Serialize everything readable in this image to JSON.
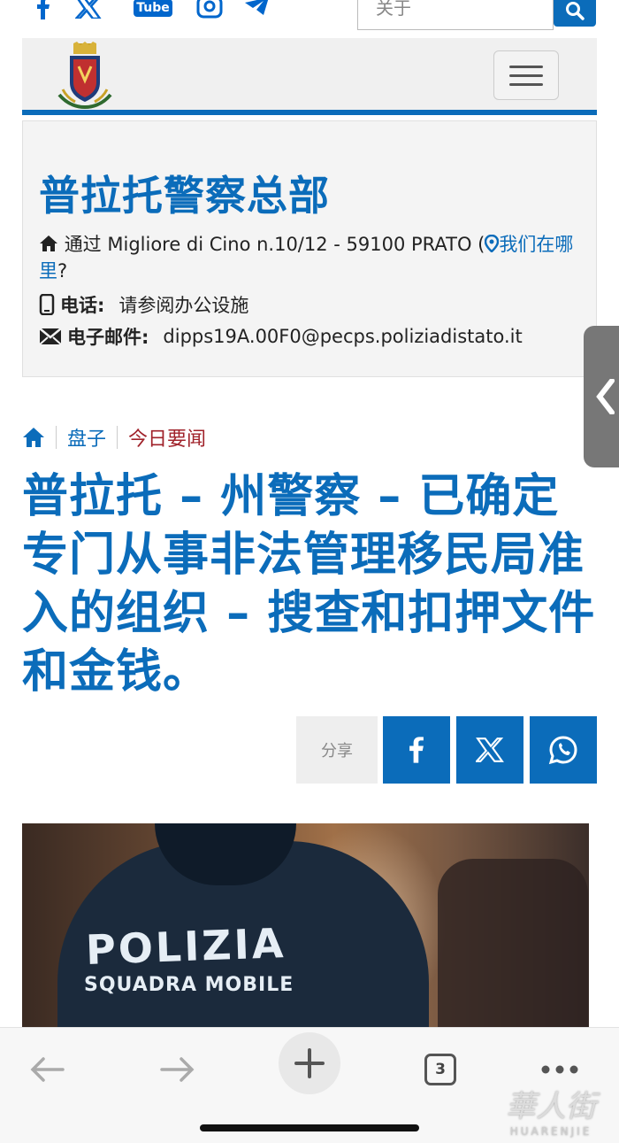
{
  "topbar": {
    "social_icons": [
      "facebook-icon",
      "x-icon",
      "youtube-icon",
      "instagram-icon",
      "telegram-icon"
    ],
    "youtube_label": "Tube",
    "search_placeholder": "关于"
  },
  "info": {
    "office_title": "普拉托警察总部",
    "address_prefix": "通过 Migliore di Cino n.10/12 - 59100 PRATO (",
    "address_link": "我们在哪里",
    "address_suffix": "?",
    "phone_label": "电话:",
    "phone_value": "请参阅办公设施",
    "email_label": "电子邮件:",
    "email_value": "dipps19A.00F0@pecps.poliziadistato.it"
  },
  "breadcrumb": {
    "item1": "盘子",
    "item2": "今日要闻"
  },
  "article": {
    "headline": "普拉托 – 州警察 – 已确定专门从事非法管理移民局准入的组织 – 搜查和扣押文件和金钱。",
    "share_label": "分享"
  },
  "photo": {
    "jacket_text_1": "POLIZIA",
    "jacket_text_2": "SQUADRA MOBILE"
  },
  "toolbar": {
    "tabs_count": "3"
  },
  "watermark": {
    "line1": "華人街",
    "line2": "HUARENJIE"
  },
  "colors": {
    "brand_blue": "#0b6cba",
    "breadcrumb_red": "#a0222a"
  }
}
